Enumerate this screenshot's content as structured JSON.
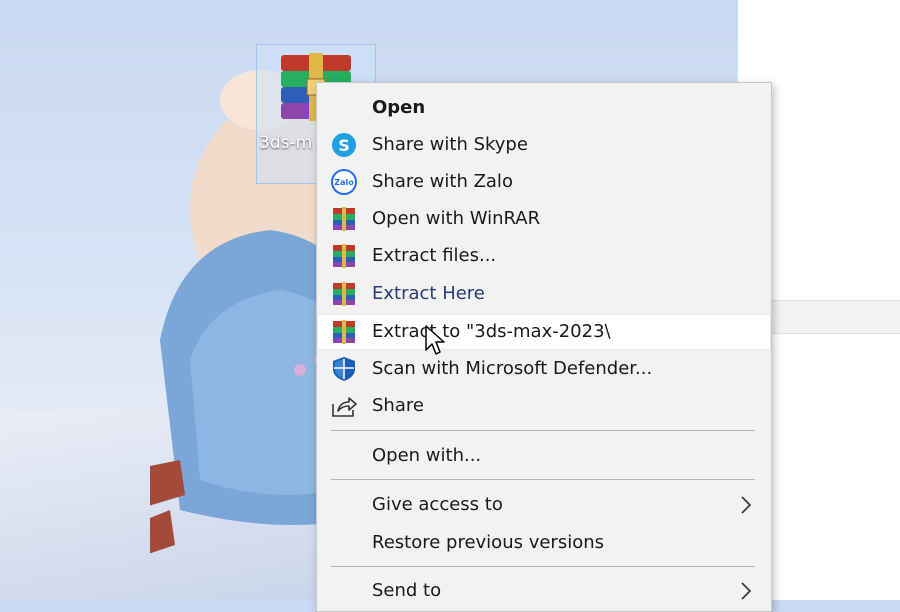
{
  "desktop": {
    "icon_label": "3ds-m"
  },
  "context_menu": {
    "items": [
      {
        "label": "Open",
        "icon": "none"
      },
      {
        "label": "Share with Skype",
        "icon": "skype-icon"
      },
      {
        "label": "Share with Zalo",
        "icon": "zalo-icon",
        "icon_text": "Zalo"
      },
      {
        "label": "Open with WinRAR",
        "icon": "winrar-icon"
      },
      {
        "label": "Extract files...",
        "icon": "winrar-icon"
      },
      {
        "label": "Extract Here",
        "icon": "winrar-icon"
      },
      {
        "label": "Extract to \"3ds-max-2023\\",
        "icon": "winrar-icon"
      },
      {
        "label": "Scan with Microsoft Defender...",
        "icon": "defender-shield-icon"
      },
      {
        "label": "Share",
        "icon": "share-icon"
      },
      {
        "label": "Open with...",
        "icon": "none"
      },
      {
        "label": "Give access to",
        "icon": "none",
        "submenu": true
      },
      {
        "label": "Restore previous versions",
        "icon": "none"
      },
      {
        "label": "Send to",
        "icon": "none",
        "submenu": true
      }
    ]
  },
  "colors": {
    "menu_bg": "#f2f2f2",
    "hover_bg": "#ffffff",
    "skype_blue": "#1fa0e0",
    "zalo_blue": "#1f6ee8",
    "defender_blue": "#1a5fb4"
  }
}
